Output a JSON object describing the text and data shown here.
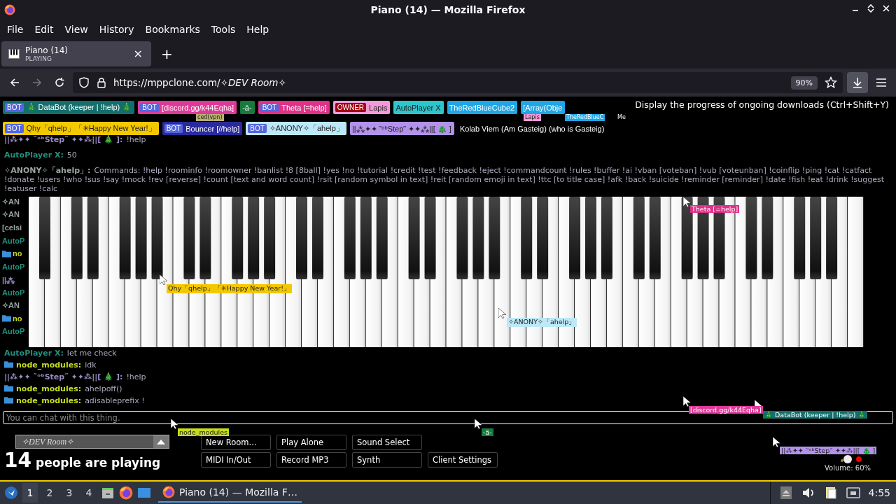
{
  "window": {
    "title": "Piano (14) — Mozilla Firefox"
  },
  "menu": [
    "File",
    "Edit",
    "View",
    "History",
    "Bookmarks",
    "Tools",
    "Help"
  ],
  "tab": {
    "title": "Piano (14)",
    "status": "PLAYING",
    "close": "×",
    "new_tab": "+"
  },
  "address_bar": {
    "url": "https://mppclone.com/*✧DEV Room✧*",
    "zoom": "90%"
  },
  "tooltip": "Display the progress of ongoing downloads (Ctrl+Shift+Y)",
  "user_rows": [
    [
      {
        "tag": {
          "label": "BOT",
          "kind": "bot"
        },
        "name": "🎄 DataBot (keeper | !help) 🎄",
        "color": "#146e6c"
      },
      {
        "tag": {
          "label": "BOT",
          "kind": "bot"
        },
        "name": "[discord.gg/k44Eqha]",
        "color": "#de3a98"
      },
      {
        "name": "-ä-",
        "color": "#177a3c"
      },
      {
        "tag": {
          "label": "BOT",
          "kind": "bot"
        },
        "name": "Theta [=help]",
        "color": "#e03088"
      },
      {
        "tag": {
          "label": "OWNER",
          "kind": "owner"
        },
        "name": "Lapis",
        "color": "#f29ad8"
      },
      {
        "name": "AutoPlayer X",
        "color": "#2cc6cc"
      },
      {
        "name": "TheRedBlueCube2",
        "color": "#1ea6e6"
      },
      {
        "name": "[Array(Obje",
        "color": "#1ea6e6"
      }
    ],
    [
      {
        "tag": {
          "label": "BOT",
          "kind": "bot"
        },
        "name": "Qhy「qhelp」「✳Happy New Year!」",
        "color": "#f4c800"
      },
      {
        "tag": {
          "label": "BOT",
          "kind": "bot"
        },
        "name": "Bouncer [//help]",
        "color": "#2a2a9e"
      },
      {
        "tag": {
          "label": "BOT",
          "kind": "bot"
        },
        "name": "✧ANONY✧「ahelp」",
        "color": "#bce8f8"
      },
      {
        "name": "||⁂✦✦ ˜ᵒᵇStep˜ ✦✦⁂||[ 🎄 ]",
        "color": "#b292ea"
      },
      {
        "name": "Kolab Viem (Am Gasteig) (who is Gasteig)",
        "color": "#000000"
      }
    ]
  ],
  "chat_top": [
    {
      "name": "||⁂✦✦ ˜ᵒᵇStep˜ ✦✦⁂||[ 🎄 ]:",
      "text": "!help",
      "color": "#9c8cc4"
    },
    {
      "name": "AutoPlayer X:",
      "text": "50",
      "color": "#23907e"
    },
    {
      "name": "✧ANONY✧「ahelp」:",
      "text": "Commands: !help !roominfo !roomowner !banlist !8 [8ball] !yes !no !tutorial !credit !test !feedback !eject !commandcount !rules !buffer !ai !vban [voteban] !vub [voteunban] !coinflip !ping !cat !catfact !donate !users !who !sus !say !mock !rev [reverse] !count [text and word count] !rsit [random symbol in text] !reit [random emoji in text] !ttc [to title case] !afk !back !suicide !reminder [reminder] !date !fish !eat !drink !suggest !eatuser !calc",
      "color": "#9aa4a4"
    }
  ],
  "chat_hidden_fragments": [
    {
      "text": "✧AN",
      "color": "#9aa4a4"
    },
    {
      "text": "✧AN",
      "color": "#9aa4a4"
    },
    {
      "text": "[celsi",
      "color": "#9aa4a4"
    },
    {
      "text": "AutoP",
      "color": "#23907e"
    },
    {
      "text": "no",
      "color": "#c6de1e",
      "kind": "folder"
    },
    {
      "text": "AutoP",
      "color": "#23907e"
    },
    {
      "text": "||⁂",
      "color": "#9c8cc4"
    },
    {
      "text": "AutoP",
      "color": "#23907e"
    },
    {
      "text": "✧AN",
      "color": "#9aa4a4"
    },
    {
      "text": "no",
      "color": "#c6de1e",
      "kind": "folder"
    },
    {
      "text": "AutoP",
      "color": "#23907e"
    }
  ],
  "chat_bottom": [
    {
      "name": "AutoPlayer X:",
      "text": "let me check",
      "color": "#23907e"
    },
    {
      "name": "node_modules:",
      "text": "idk",
      "color": "#c6de1e",
      "kind": "folder"
    },
    {
      "name": "||⁂✦✦ ˜ᵒᵇStep˜ ✦✦⁂||[ 🎄 ]:",
      "text": "!help",
      "color": "#9c8cc4"
    },
    {
      "name": "node_modules:",
      "text": "ahelpoff()",
      "color": "#c6de1e",
      "kind": "folder"
    },
    {
      "name": "node_modules:",
      "text": "adisableprefix !",
      "color": "#c6de1e",
      "kind": "folder"
    }
  ],
  "cursors": [
    {
      "label": "ced(vpn)",
      "color": "#b8b070"
    },
    {
      "label": "Lapis",
      "color": "#f29ad8"
    },
    {
      "label": "TheRedBlueC",
      "color": "#1ea6e6"
    },
    {
      "label": "Me",
      "color": "#000000"
    },
    {
      "label": "Theta [=help]",
      "color": "#e03088"
    },
    {
      "label": "Qhy「qhelp」「✳Happy New Year!」",
      "color": "#f4c800"
    },
    {
      "label": "✧ANONY✧「ahelp」",
      "color": "#bce8f8"
    },
    {
      "label": "[discord.gg/k44Eqha]",
      "color": "#de3a98"
    },
    {
      "label": "🎄 DataBot (keeper | !help) 🎄",
      "color": "#146e6c"
    },
    {
      "label": "-ä-",
      "color": "#177a3c"
    },
    {
      "label": "node_modules",
      "color": "#c6de1e"
    },
    {
      "label": "||⁂✦✦ ˜ᵒᵇStep˜ ✦✦⁂||[ 🎄 ]",
      "color": "#b292ea"
    }
  ],
  "chat_input": {
    "placeholder": "You can chat with this thing."
  },
  "room_select": {
    "value": "✧DEV Room✧"
  },
  "player_count": {
    "count": "14",
    "text": "people are playing"
  },
  "buttons": [
    [
      "New Room...",
      "Play Alone",
      "Sound Select"
    ],
    [
      "MIDI In/Out",
      "Record MP3",
      "Synth",
      "Client Settings"
    ]
  ],
  "volume": {
    "reading": "Volume: 60%"
  },
  "taskbar": {
    "workspaces": [
      {
        "label": "1",
        "selected": true
      },
      {
        "label": "2",
        "selected": false
      },
      {
        "label": "3",
        "selected": false
      },
      {
        "label": "4",
        "selected": false
      }
    ],
    "task": "Piano (14) — Mozilla F…",
    "clock": "4:55"
  }
}
